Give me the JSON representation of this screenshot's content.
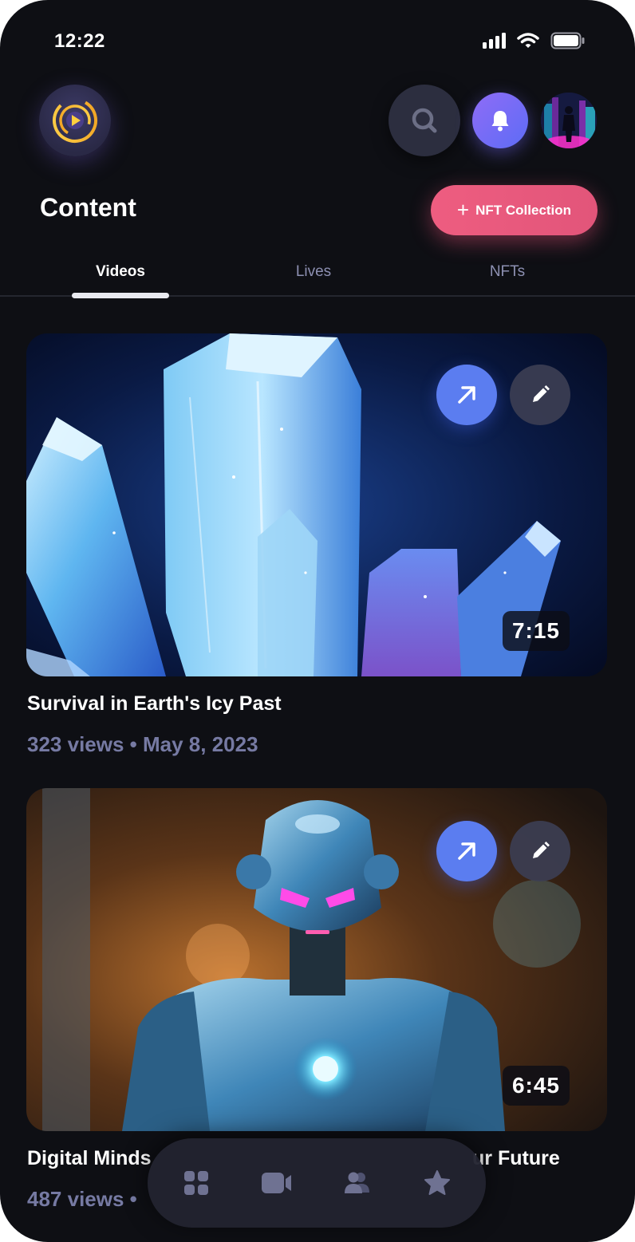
{
  "status_bar": {
    "time": "12:22"
  },
  "header": {
    "title": "Content",
    "nft_button_label": "NFT Collection",
    "icons": [
      "play-logo-icon",
      "search-icon",
      "bell-icon",
      "avatar"
    ]
  },
  "tabs": [
    {
      "label": "Videos",
      "active": true
    },
    {
      "label": "Lives",
      "active": false
    },
    {
      "label": "NFTs",
      "active": false
    }
  ],
  "videos": [
    {
      "title": "Survival in Earth's Icy Past",
      "meta": "323 views • May 8, 2023",
      "duration": "7:15"
    },
    {
      "title": "Digital Minds",
      "title_tail": "ur Future",
      "meta": "487 views •",
      "duration": "6:45"
    }
  ],
  "bottom_nav": {
    "items": [
      "grid-icon",
      "video-camera-icon",
      "users-icon",
      "star-icon"
    ]
  },
  "colors": {
    "background": "#0e0f14",
    "accent_pink": "#e9577d",
    "accent_blue": "#5b7df0",
    "accent_purple": "#7f6cf6",
    "muted_text": "#767aa3"
  }
}
